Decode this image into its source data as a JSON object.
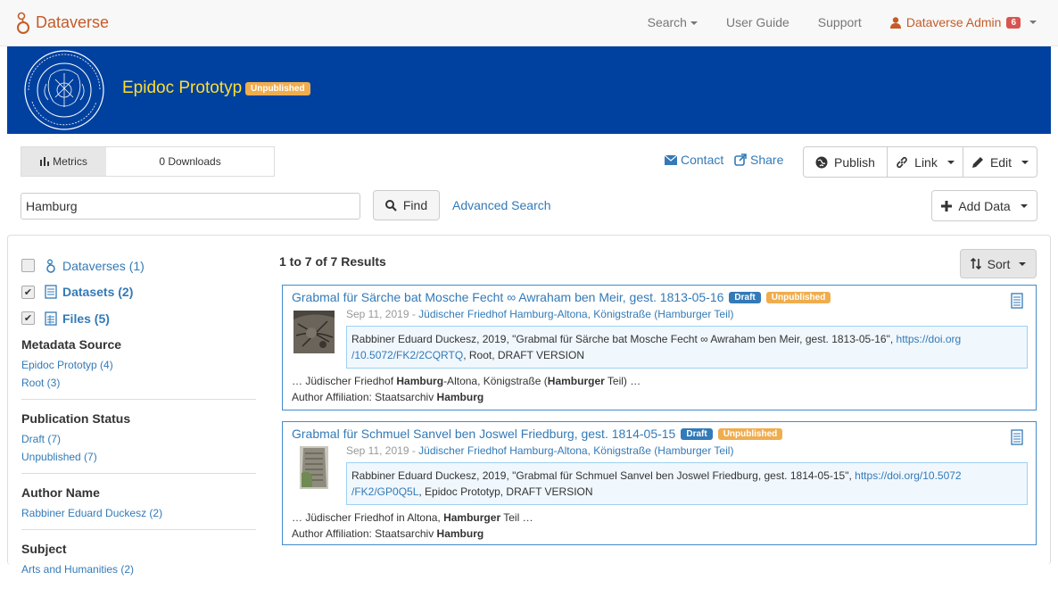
{
  "navbar": {
    "brand": "Dataverse",
    "search": "Search",
    "user_guide": "User Guide",
    "support": "Support",
    "user_name": "Dataverse Admin",
    "notification_count": "6"
  },
  "dataverse": {
    "title": "Epidoc Prototyp",
    "status": "Unpublished"
  },
  "metrics": {
    "tab": "Metrics",
    "downloads": "0 Downloads"
  },
  "actions": {
    "contact": "Contact",
    "share": "Share",
    "publish": "Publish",
    "link": "Link",
    "edit": "Edit",
    "add_data": "Add Data"
  },
  "search": {
    "value": "Hamburg",
    "find": "Find",
    "advanced": "Advanced Search"
  },
  "types": [
    {
      "label": "Dataverses (1)",
      "checked": false
    },
    {
      "label": "Datasets (2)",
      "checked": true
    },
    {
      "label": "Files (5)",
      "checked": true
    }
  ],
  "facets": [
    {
      "title": "Metadata Source",
      "items": [
        "Epidoc Prototyp (4)",
        "Root (3)"
      ]
    },
    {
      "title": "Publication Status",
      "items": [
        "Draft (7)",
        "Unpublished (7)"
      ]
    },
    {
      "title": "Author Name",
      "items": [
        "Rabbiner Eduard Duckesz (2)"
      ]
    },
    {
      "title": "Subject",
      "items": [
        "Arts and Humanities (2)"
      ]
    }
  ],
  "results": {
    "count": "1 to 7 of 7 Results",
    "sort": "Sort",
    "items": [
      {
        "title": "Grabmal für Särche bat Mosche Fecht ∞ Awraham ben Meir, gest. 1813-05-16",
        "label_draft": "Draft",
        "label_unpublished": "Unpublished",
        "date": "Sep 11, 2019 - ",
        "parent": "Jüdischer Friedhof Hamburg-Altona, Königstraße (Hamburger Teil)",
        "citation": "Rabbiner Eduard Duckesz, 2019, \"Grabmal für Särche bat Mosche Fecht ∞ Awraham ben Meir, gest. 1813-05-16\",",
        "doi_line1": "https://doi.org",
        "doi_line2": "/10.5072/FK2/2CQRTQ",
        "citation_tail": ", Root, DRAFT VERSION",
        "snippet_pre": "… Jüdischer Friedhof ",
        "snippet_hl1": "Hamburg",
        "snippet_mid": "-Altona, Königstraße (",
        "snippet_hl2": "Hamburger",
        "snippet_post": " Teil) …",
        "affil_label": "Author Affiliation: Staatsarchiv ",
        "affil_hl": "Hamburg"
      },
      {
        "title": "Grabmal für Schmuel Sanvel ben Joswel Friedburg, gest. 1814-05-15",
        "label_draft": "Draft",
        "label_unpublished": "Unpublished",
        "date": "Sep 11, 2019 - ",
        "parent": "Jüdischer Friedhof Hamburg-Altona, Königstraße (Hamburger Teil)",
        "citation": "Rabbiner Eduard Duckesz, 2019, \"Grabmal für Schmuel Sanvel ben Joswel Friedburg, gest. 1814-05-15\",",
        "doi_line1": "https://doi.org/10.5072",
        "doi_line2": "/FK2/GP0Q5L",
        "citation_tail": ", Epidoc Prototyp, DRAFT VERSION",
        "snippet_pre": "… Jüdischer Friedhof in Altona, ",
        "snippet_hl1": "Hamburger",
        "snippet_mid": " Teil …",
        "snippet_hl2": "",
        "snippet_post": "",
        "affil_label": "Author Affiliation: Staatsarchiv ",
        "affil_hl": "Hamburg"
      }
    ]
  }
}
